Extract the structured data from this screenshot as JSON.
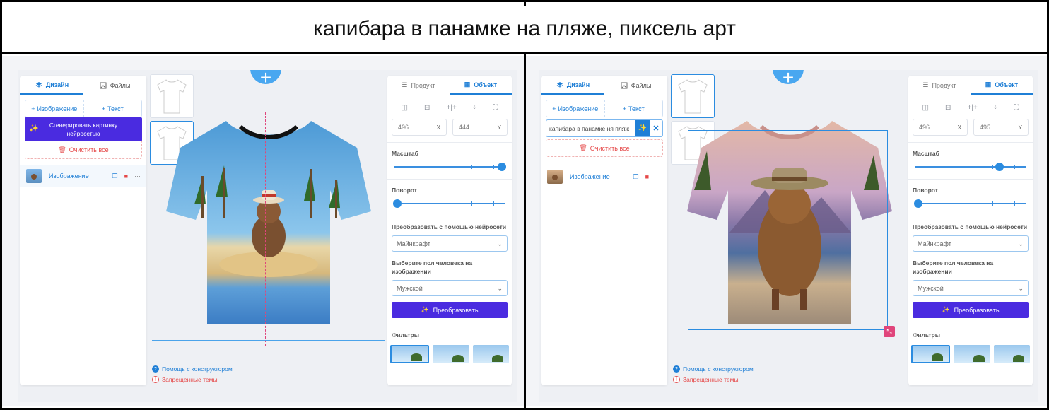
{
  "caption": "капибара в панамке на пляже, пиксель арт",
  "colors": {
    "accent": "#1f7fd6",
    "purple": "#4a2be0",
    "danger": "#e54848"
  },
  "panels": [
    {
      "left": {
        "tabs": [
          {
            "label": "Дизайн",
            "icon": "layers-icon"
          },
          {
            "label": "Файлы",
            "icon": "image-icon"
          }
        ],
        "add_image": "Изображение",
        "add_text": "Текст",
        "generate": "Сгенерировать картинку нейросетью",
        "clear": "Очистить все",
        "layer_label": "Изображение"
      },
      "right": {
        "tabs": [
          {
            "label": "Продукт"
          },
          {
            "label": "Объект"
          }
        ],
        "x": "496",
        "x_axis": "X",
        "y": "444",
        "y_axis": "Y",
        "scale_label": "Масштаб",
        "scale_value": 1.0,
        "rotate_label": "Поворот",
        "rotate_value": 0.0,
        "transform_label": "Преобразовать с помощью нейросети",
        "style_option": "Майнкрафт",
        "gender_label": "Выберите пол человека на изображении",
        "gender_option": "Мужской",
        "convert": "Преобразовать",
        "filters_label": "Фильтры"
      },
      "help": "Помощь с конструктором",
      "forbidden": "Запрещенные темы"
    },
    {
      "left": {
        "tabs": [
          {
            "label": "Дизайн",
            "icon": "layers-icon"
          },
          {
            "label": "Файлы",
            "icon": "image-icon"
          }
        ],
        "add_image": "Изображение",
        "add_text": "Текст",
        "prompt": "капибара в панамке ня пляж",
        "clear": "Очистить все",
        "layer_label": "Изображение"
      },
      "right": {
        "tabs": [
          {
            "label": "Продукт"
          },
          {
            "label": "Объект"
          }
        ],
        "x": "496",
        "x_axis": "X",
        "y": "495",
        "y_axis": "Y",
        "scale_label": "Масштаб",
        "scale_value": 0.76,
        "rotate_label": "Поворот",
        "rotate_value": 0.0,
        "transform_label": "Преобразовать с помощью нейросети",
        "style_option": "Майнкрафт",
        "gender_label": "Выберите пол человека на изображении",
        "gender_option": "Мужской",
        "convert": "Преобразовать",
        "filters_label": "Фильтры"
      },
      "help": "Помощь с конструктором",
      "forbidden": "Запрещенные темы"
    }
  ]
}
